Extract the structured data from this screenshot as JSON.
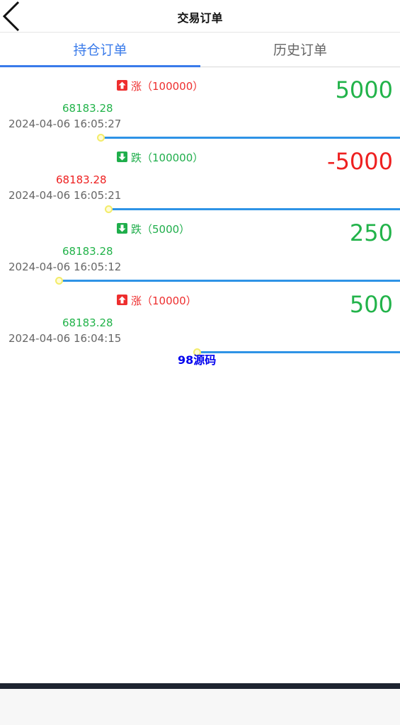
{
  "header": {
    "title": "交易订单"
  },
  "tabs": [
    {
      "label": "持仓订单",
      "active": true
    },
    {
      "label": "历史订单",
      "active": false
    }
  ],
  "orders": [
    {
      "direction": "up",
      "dir_label": "涨（100000）",
      "amount": "5000",
      "amount_color": "green",
      "price": "68183.28",
      "price_color": "green",
      "time": "2024-04-06 16:05:27",
      "progress_start_fraction": 0.25
    },
    {
      "direction": "down",
      "dir_label": "跌（100000）",
      "amount": "-5000",
      "amount_color": "red",
      "price": "68183.28",
      "price_color": "red",
      "time": "2024-04-06 16:05:21",
      "progress_start_fraction": 0.27
    },
    {
      "direction": "down",
      "dir_label": "跌（5000）",
      "amount": "250",
      "amount_color": "green",
      "price": "68183.28",
      "price_color": "green",
      "time": "2024-04-06 16:05:12",
      "progress_start_fraction": 0.15
    },
    {
      "direction": "up",
      "dir_label": "涨（10000）",
      "amount": "500",
      "amount_color": "green",
      "price": "68183.28",
      "price_color": "green",
      "time": "2024-04-06 16:04:15",
      "progress_start_fraction": 0.49
    }
  ],
  "watermark": "98源码",
  "colors": {
    "accent": "#3a7bea",
    "up_red": "#ee2e2e",
    "down_green": "#1fae4b",
    "progress": "#2e93e6"
  }
}
